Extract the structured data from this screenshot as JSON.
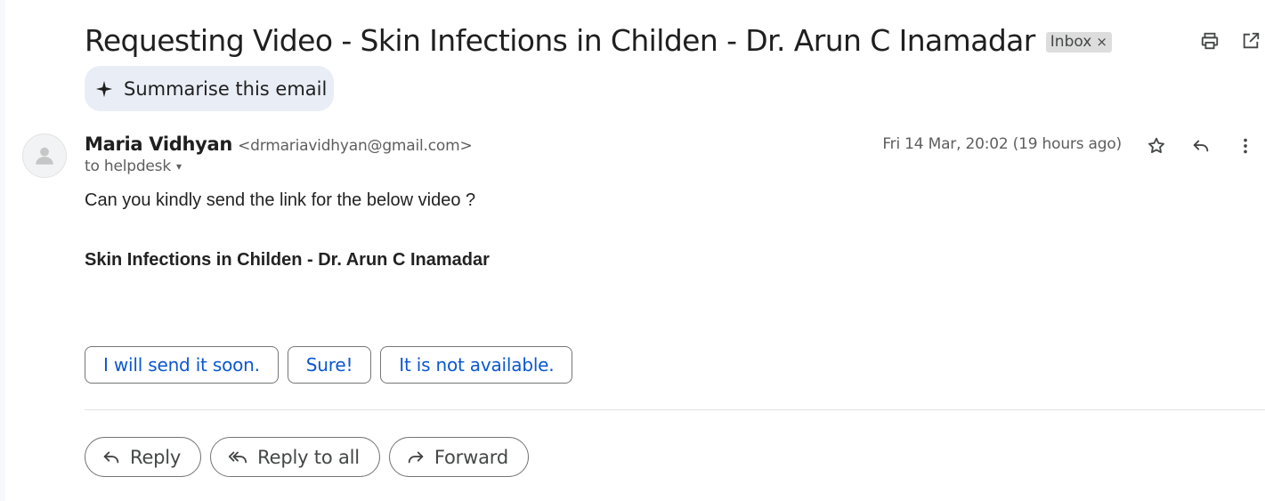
{
  "email": {
    "subject": "Requesting Video - Skin Infections in Childen - Dr. Arun C Inamadar",
    "label": "Inbox",
    "label_remove": "×",
    "summarise_label": "Summarise this email",
    "sender_name": "Maria Vidhyan",
    "sender_email": "<drmariavidhyan@gmail.com>",
    "to_line": "to helpdesk",
    "date": "Fri 14 Mar, 20:02 (19 hours ago)",
    "body_line": "Can you kindly send the link for the below video ?",
    "body_bold": "Skin Infections in Childen - Dr. Arun C Inamadar"
  },
  "smart_replies": [
    "I will send it soon.",
    "Sure!",
    "It is not available."
  ],
  "actions": {
    "reply": "Reply",
    "reply_all": "Reply to all",
    "forward": "Forward"
  },
  "icons": {
    "print": "print-icon",
    "open_new_window": "open-in-new-window-icon",
    "sparkle": "sparkle-icon",
    "avatar": "person-avatar-icon",
    "star": "star-icon",
    "reply": "reply-icon",
    "more": "more-vertical-icon",
    "reply_all": "reply-all-icon",
    "forward": "forward-icon"
  },
  "colors": {
    "link_blue": "#0b57d0",
    "chip_bg": "#e9eef6",
    "label_bg": "#dddddd"
  }
}
